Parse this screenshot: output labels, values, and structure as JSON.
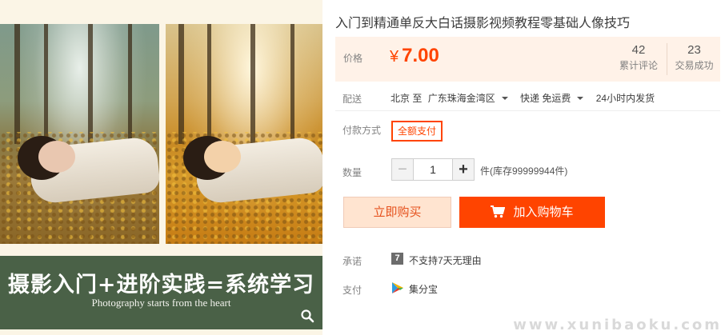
{
  "product": {
    "title": "入门到精通单反大白话摄影视频教程零基础人像技巧",
    "banner_title": "摄影入门+进阶实践=系统学习",
    "banner_subtitle": "Photography starts from the heart"
  },
  "price": {
    "label": "价格",
    "currency": "¥",
    "amount": "7.00",
    "reviews_count": "42",
    "reviews_label": "累计评论",
    "deals_count": "23",
    "deals_label": "交易成功"
  },
  "shipping": {
    "label": "配送",
    "from": "北京 至",
    "destination": "广东珠海金湾区",
    "method": "快递 免运费",
    "dispatch": "24小时内发货"
  },
  "payment_method": {
    "label": "付款方式",
    "option": "全额支付"
  },
  "quantity": {
    "label": "数量",
    "minus": "−",
    "value": "1",
    "plus": "+",
    "stock": "件(库存99999944件)"
  },
  "actions": {
    "buy_now": "立即购买",
    "add_to_cart": "加入购物车"
  },
  "promise": {
    "label": "承诺",
    "icon_text": "7",
    "text": "不支持7天无理由"
  },
  "pay": {
    "label": "支付",
    "text": "集分宝"
  },
  "watermark": "www.xunibaoku.com",
  "colors": {
    "accent": "#ff4400",
    "price_bg": "#fff2e8",
    "banner_bg": "#4a6147"
  }
}
